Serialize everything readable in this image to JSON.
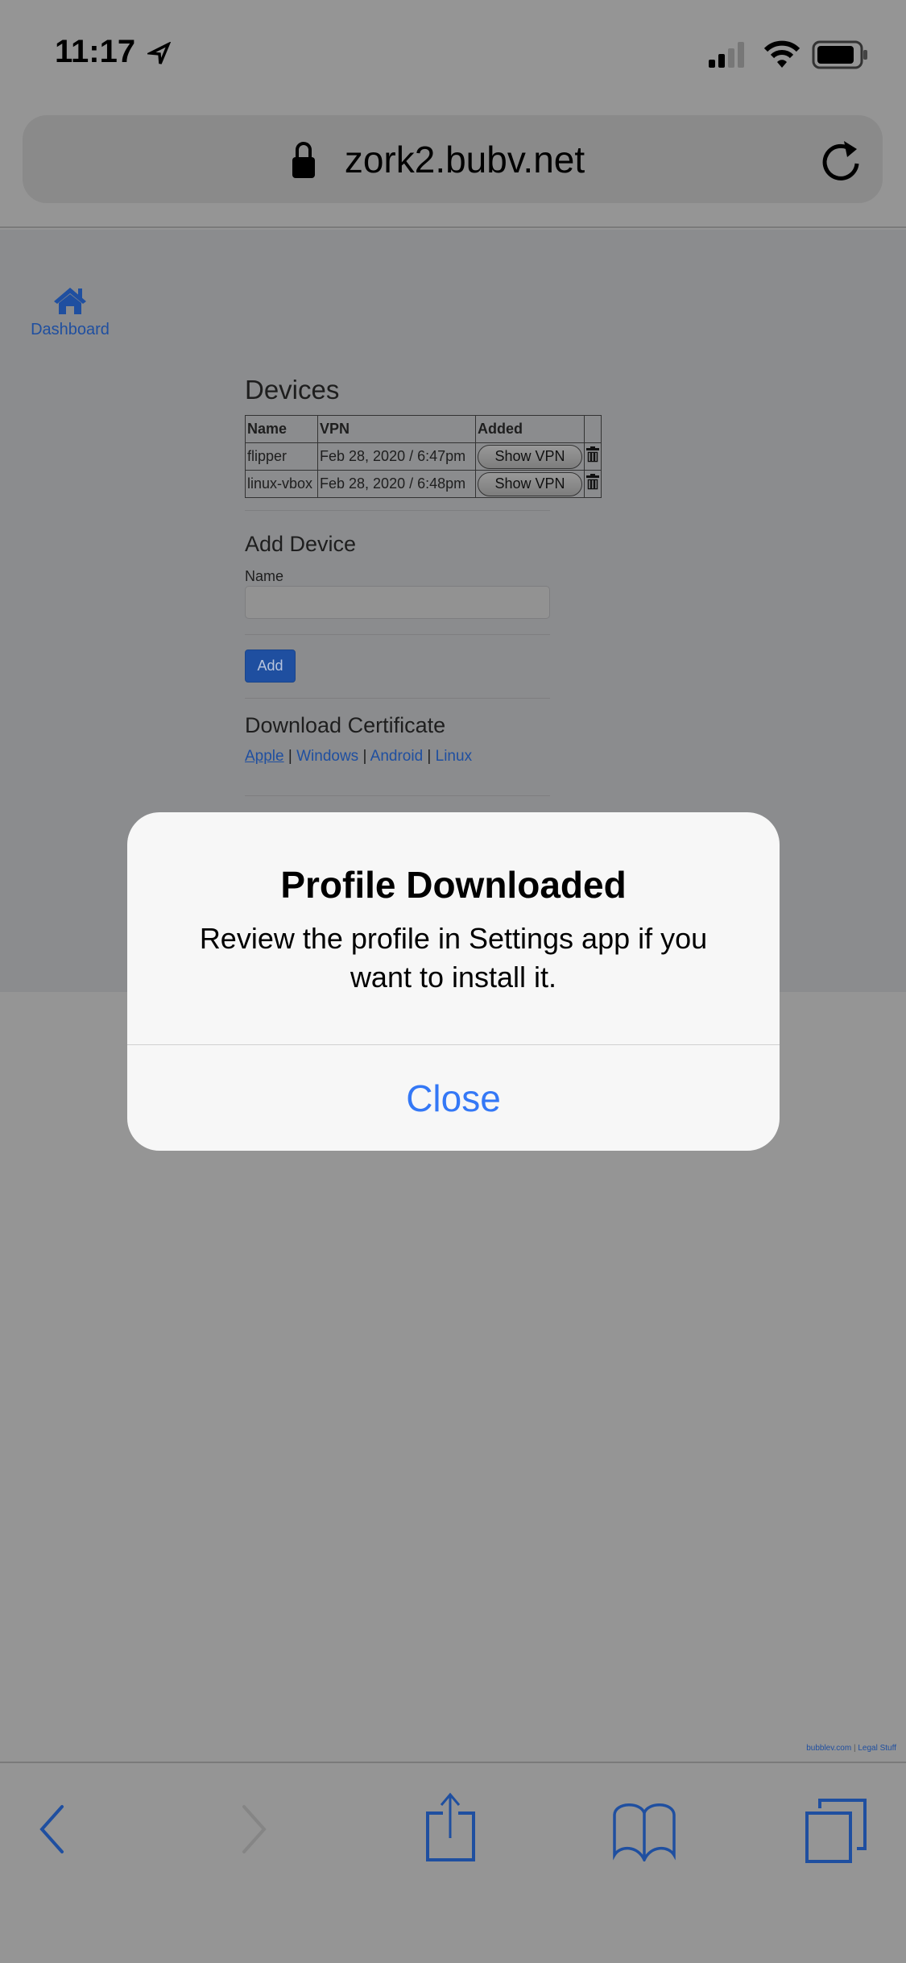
{
  "status_bar": {
    "time": "11:17",
    "icons": [
      "location-arrow-icon",
      "signal-icon",
      "wifi-icon",
      "battery-icon"
    ]
  },
  "browser": {
    "url": "zork2.bubv.net"
  },
  "nav": {
    "dashboard_label": "Dashboard"
  },
  "devices": {
    "title": "Devices",
    "columns": [
      "Name",
      "VPN",
      "Added",
      ""
    ],
    "rows": [
      {
        "name": "flipper",
        "vpn": "Feb 28, 2020 / 6:47pm",
        "button": "Show VPN"
      },
      {
        "name": "linux-vbox",
        "vpn": "Feb 28, 2020 / 6:48pm",
        "button": "Show VPN"
      }
    ]
  },
  "add_device": {
    "title": "Add Device",
    "name_label": "Name",
    "name_value": "",
    "add_label": "Add"
  },
  "download": {
    "title": "Download Certificate",
    "links": [
      "Apple",
      "Windows",
      "Android",
      "Linux"
    ],
    "separator": "|"
  },
  "footer": {
    "site": "bubblev.com",
    "sep": "|",
    "legal": "Legal Stuff"
  },
  "dialog": {
    "title": "Profile Downloaded",
    "message": "Review the profile in Settings app if you want to install it.",
    "close_label": "Close"
  },
  "colors": {
    "accent": "#3478f6",
    "link": "#1f4fa0"
  }
}
